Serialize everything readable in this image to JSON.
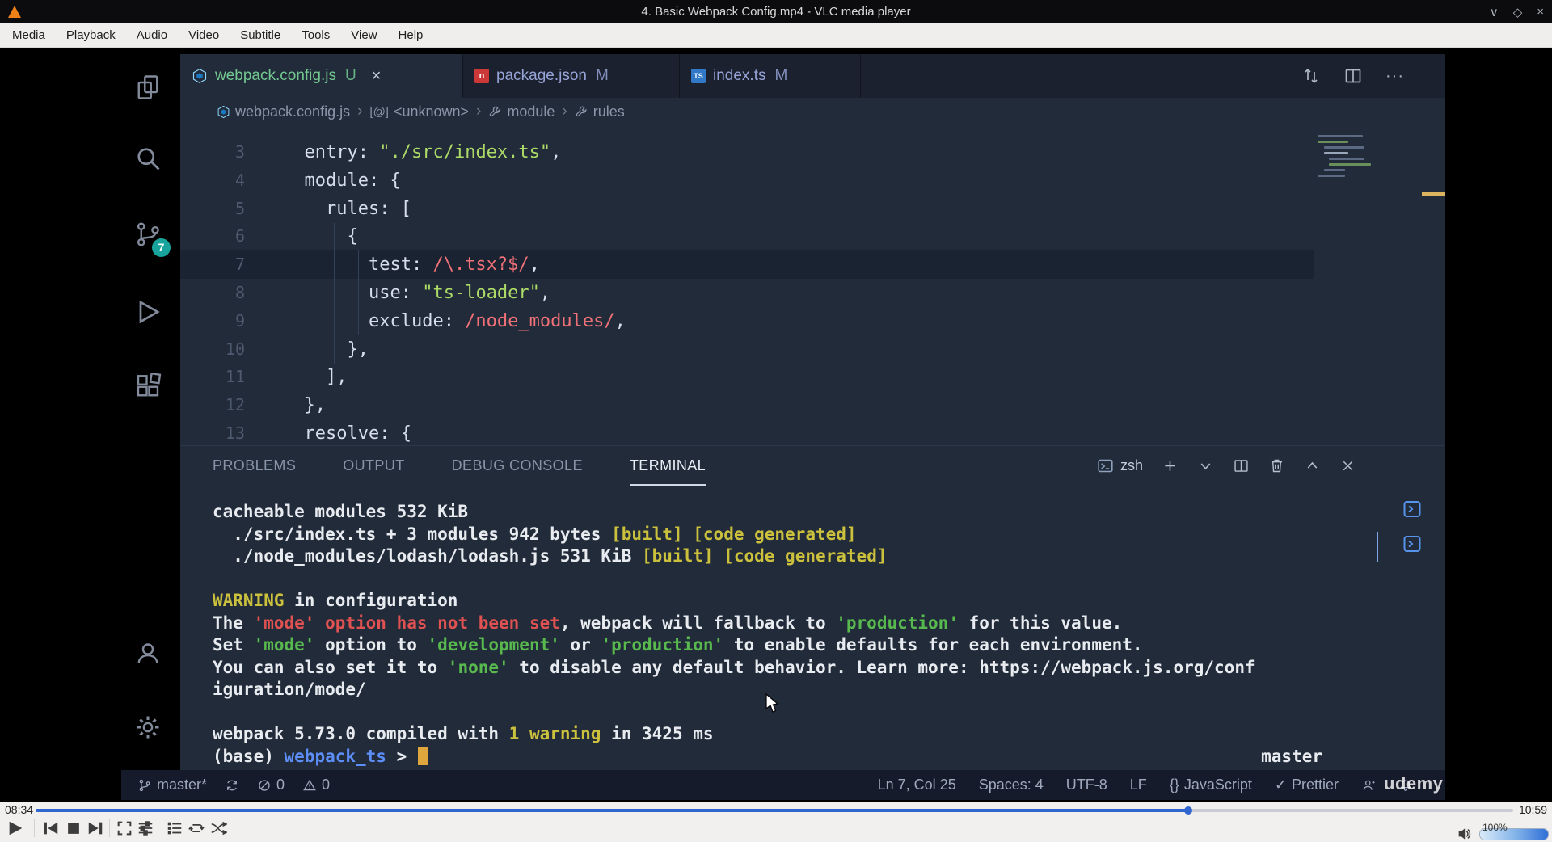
{
  "vlc": {
    "title": "4. Basic Webpack Config.mp4 - VLC media player",
    "menu": [
      "Media",
      "Playback",
      "Audio",
      "Video",
      "Subtitle",
      "Tools",
      "View",
      "Help"
    ],
    "window_controls": {
      "minimize": "∨",
      "maximize": "◇",
      "close": "×"
    },
    "time_current": "08:34",
    "time_total": "10:59",
    "progress_percent": 78,
    "volume_label": "100%"
  },
  "vscode": {
    "tabs": [
      {
        "label": "webpack.config.js",
        "git_badge": "U",
        "close": "×"
      },
      {
        "label": "package.json",
        "git_badge": "M"
      },
      {
        "label": "index.ts",
        "git_badge": "M"
      }
    ],
    "tab_actions_more": "···",
    "breadcrumb": [
      "webpack.config.js",
      "<unknown>",
      "module",
      "rules"
    ],
    "breadcrumb_symbol_icon": "[@]",
    "scm_badge": "7",
    "editor": {
      "lines": [
        {
          "num": "3",
          "segments": [
            {
              "t": "  ",
              "c": "fg"
            },
            {
              "t": "entry",
              "c": "key"
            },
            {
              "t": ": ",
              "c": "fg"
            },
            {
              "t": "\"./src/index.ts\"",
              "c": "str"
            },
            {
              "t": ",",
              "c": "fg"
            }
          ]
        },
        {
          "num": "4",
          "segments": [
            {
              "t": "  ",
              "c": "fg"
            },
            {
              "t": "module",
              "c": "key"
            },
            {
              "t": ": {",
              "c": "fg"
            }
          ]
        },
        {
          "num": "5",
          "segments": [
            {
              "t": "    ",
              "c": "fg"
            },
            {
              "t": "rules",
              "c": "key"
            },
            {
              "t": ": [",
              "c": "fg"
            }
          ]
        },
        {
          "num": "6",
          "segments": [
            {
              "t": "      {",
              "c": "fg"
            }
          ]
        },
        {
          "num": "7",
          "current": true,
          "segments": [
            {
              "t": "        ",
              "c": "fg"
            },
            {
              "t": "test",
              "c": "key"
            },
            {
              "t": ": ",
              "c": "fg"
            },
            {
              "t": "/\\.tsx?$/",
              "c": "rgx"
            },
            {
              "t": ",",
              "c": "fg"
            }
          ]
        },
        {
          "num": "8",
          "segments": [
            {
              "t": "        ",
              "c": "fg"
            },
            {
              "t": "use",
              "c": "key"
            },
            {
              "t": ": ",
              "c": "fg"
            },
            {
              "t": "\"ts-loader\"",
              "c": "str"
            },
            {
              "t": ",",
              "c": "fg"
            }
          ]
        },
        {
          "num": "9",
          "segments": [
            {
              "t": "        ",
              "c": "fg"
            },
            {
              "t": "exclude",
              "c": "key"
            },
            {
              "t": ": ",
              "c": "fg"
            },
            {
              "t": "/node_modules/",
              "c": "rgx"
            },
            {
              "t": ",",
              "c": "fg"
            }
          ]
        },
        {
          "num": "10",
          "segments": [
            {
              "t": "      },",
              "c": "fg"
            }
          ]
        },
        {
          "num": "11",
          "segments": [
            {
              "t": "    ],",
              "c": "fg"
            }
          ]
        },
        {
          "num": "12",
          "segments": [
            {
              "t": "  },",
              "c": "fg"
            }
          ]
        },
        {
          "num": "13",
          "segments": [
            {
              "t": "  ",
              "c": "fg"
            },
            {
              "t": "resolve",
              "c": "key"
            },
            {
              "t": ": {",
              "c": "fg"
            }
          ]
        }
      ]
    },
    "panel": {
      "tabs": [
        "PROBLEMS",
        "OUTPUT",
        "DEBUG CONSOLE",
        "TERMINAL"
      ],
      "active_tab": "TERMINAL",
      "shell": "zsh"
    },
    "terminal": {
      "lines": [
        {
          "segments": [
            {
              "t": "cacheable modules 532 KiB",
              "c": "tfg"
            }
          ]
        },
        {
          "segments": [
            {
              "t": "  ./src/index.ts + 3 modules 942 bytes ",
              "c": "tfg"
            },
            {
              "t": "[built]",
              "c": "yel"
            },
            {
              "t": " ",
              "c": "tfg"
            },
            {
              "t": "[code generated]",
              "c": "yel"
            }
          ]
        },
        {
          "segments": [
            {
              "t": "  ./node_modules/lodash/lodash.js 531 KiB ",
              "c": "tfg"
            },
            {
              "t": "[built]",
              "c": "yel"
            },
            {
              "t": " ",
              "c": "tfg"
            },
            {
              "t": "[code generated]",
              "c": "yel"
            }
          ]
        },
        {
          "segments": []
        },
        {
          "segments": [
            {
              "t": "WARNING",
              "c": "yel"
            },
            {
              "t": " in configuration",
              "c": "tfg"
            }
          ]
        },
        {
          "segments": [
            {
              "t": "The ",
              "c": "tfg"
            },
            {
              "t": "'mode' option has not been set",
              "c": "red"
            },
            {
              "t": ", webpack will fallback to ",
              "c": "tfg"
            },
            {
              "t": "'production'",
              "c": "grn"
            },
            {
              "t": " for this value.",
              "c": "tfg"
            }
          ]
        },
        {
          "segments": [
            {
              "t": "Set ",
              "c": "tfg"
            },
            {
              "t": "'mode'",
              "c": "grn"
            },
            {
              "t": " option to ",
              "c": "tfg"
            },
            {
              "t": "'development'",
              "c": "grn"
            },
            {
              "t": " or ",
              "c": "tfg"
            },
            {
              "t": "'production'",
              "c": "grn"
            },
            {
              "t": " to enable defaults for each environment.",
              "c": "tfg"
            }
          ]
        },
        {
          "segments": [
            {
              "t": "You can also set it to ",
              "c": "tfg"
            },
            {
              "t": "'none'",
              "c": "grn"
            },
            {
              "t": " to disable any default behavior. Learn more: https://webpack.js.org/conf",
              "c": "tfg"
            }
          ]
        },
        {
          "segments": [
            {
              "t": "iguration/mode/",
              "c": "tfg"
            }
          ]
        },
        {
          "segments": []
        },
        {
          "segments": [
            {
              "t": "webpack 5.73.0 compiled with ",
              "c": "tfg"
            },
            {
              "t": "1 warning",
              "c": "yel"
            },
            {
              "t": " in 3425 ms",
              "c": "tfg"
            }
          ]
        },
        {
          "segments": [
            {
              "t": "(base) ",
              "c": "tfg"
            },
            {
              "t": "webpack_ts",
              "c": "blu"
            },
            {
              "t": " > ",
              "c": "tfg"
            }
          ],
          "cursor": true
        }
      ],
      "right_prompt": "master"
    },
    "statusbar": {
      "branch": "master*",
      "errors": "0",
      "warnings": "0",
      "cursor_position": "Ln 7, Col 25",
      "indentation": "Spaces: 4",
      "encoding": "UTF-8",
      "eol": "LF",
      "language": "JavaScript",
      "language_icon": "{}",
      "formatter": "Prettier",
      "formatter_icon": "✓"
    }
  },
  "watermark": "udemy"
}
